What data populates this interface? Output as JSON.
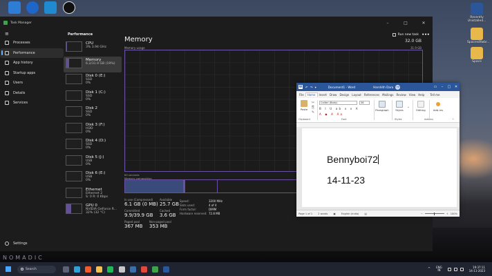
{
  "desktop": {
    "brand_text": "NOMADIC",
    "icons_right": [
      {
        "label": "Recently Unistalled...",
        "color": "#2b579a"
      },
      {
        "label": "Spaces4fwbr...",
        "color": "#e8b84a"
      },
      {
        "label": "Space",
        "color": "#e8b84a"
      }
    ]
  },
  "task_manager": {
    "window_title": "Task Manager",
    "section_title": "Performance",
    "run_new_task": "Run new task",
    "more": "•••",
    "sidebar": [
      {
        "label": "Processes",
        "name": "processes"
      },
      {
        "label": "Performance",
        "name": "performance",
        "active": true
      },
      {
        "label": "App history",
        "name": "app-history"
      },
      {
        "label": "Startup apps",
        "name": "startup-apps"
      },
      {
        "label": "Users",
        "name": "users"
      },
      {
        "label": "Details",
        "name": "details"
      },
      {
        "label": "Services",
        "name": "services"
      }
    ],
    "settings_label": "Settings",
    "perf_items": [
      {
        "name": "CPU",
        "l1": "3% 3.94 GHz",
        "l2": "",
        "l3": "",
        "fill": 0.03
      },
      {
        "name": "Memory",
        "l1": "6.2/31.9 GB (19%)",
        "l2": "",
        "l3": "",
        "fill": 0.19,
        "active": true
      },
      {
        "name": "Disk 0 (E:)",
        "l1": "SSD",
        "l2": "0%",
        "l3": "",
        "fill": 0.0
      },
      {
        "name": "Disk 1 (C:)",
        "l1": "SSD",
        "l2": "0%",
        "l3": "",
        "fill": 0.0
      },
      {
        "name": "Disk 2",
        "l1": "SSD",
        "l2": "0%",
        "l3": "",
        "fill": 0.0
      },
      {
        "name": "Disk 3 (F:)",
        "l1": "HDD",
        "l2": "0%",
        "l3": "",
        "fill": 0.0
      },
      {
        "name": "Disk 4 (D:)",
        "l1": "SSD",
        "l2": "0%",
        "l3": "",
        "fill": 0.0
      },
      {
        "name": "Disk 5 (J:)",
        "l1": "USB",
        "l2": "0%",
        "l3": "",
        "fill": 0.0
      },
      {
        "name": "Disk 6 (E:)",
        "l1": "USB",
        "l2": "0%",
        "l3": "",
        "fill": 0.0
      },
      {
        "name": "Ethernet",
        "l1": "Ethernet 2",
        "l2": "S: 0 R: 0 Kbps",
        "l3": "",
        "fill": 0.0
      },
      {
        "name": "GPU 0",
        "l1": "NVIDIA GeForce R...",
        "l2": "32% (32 °C)",
        "l3": "",
        "fill": 0.32
      }
    ],
    "memory": {
      "title": "Memory",
      "subtitle": "Memory usage",
      "total": "32.0 GB",
      "max_label": "31.9 GB",
      "graph_left_label": "60 seconds",
      "graph_right_label": "0",
      "composition_label": "Memory composition",
      "in_use_label": "In use (Compressed)",
      "in_use_value": "6.1 GB (0 MB)",
      "available_label": "Available",
      "available_value": "25.7 GB",
      "committed_label": "Committed",
      "committed_value": "9.9/39.9 GB",
      "cached_label": "Cached",
      "cached_value": "3.6 GB",
      "paged_label": "Paged pool",
      "paged_value": "367 MB",
      "nonpaged_label": "Non-paged pool",
      "nonpaged_value": "353 MB",
      "specs": [
        {
          "k": "Speed:",
          "v": "3200 MHz"
        },
        {
          "k": "Slots used:",
          "v": "4 of 4"
        },
        {
          "k": "Form factor:",
          "v": "DIMM"
        },
        {
          "k": "Hardware reserved:",
          "v": "72.8 MB"
        }
      ]
    }
  },
  "word": {
    "qa_icons": "↶ ↷ ▾",
    "doc_title": "Document1 - Word",
    "user": "Harshith Dara",
    "avatar": "HD",
    "tabs": [
      "File",
      "Home",
      "Insert",
      "Draw",
      "Design",
      "Layout",
      "References",
      "Mailings",
      "Review",
      "View",
      "Help"
    ],
    "active_tab": "Home",
    "tell_me": "Tell me",
    "font_name": "Calibri (Body)",
    "font_size": "36",
    "groups": {
      "clipboard": "Clipboard",
      "font": "Font",
      "styles": "Styles",
      "editing": "Editing",
      "addins": "Add-ins",
      "paste": "Paste",
      "paragraph": "Paragraph",
      "styles_btn": "Styles",
      "editing_btn": "Editing",
      "addins_btn": "Add-ins"
    },
    "format_glyphs": "B I U ab x x A",
    "lines": [
      "Bennyboi72",
      "14-11-23"
    ],
    "status": {
      "page": "Page 1 of 1",
      "words": "2 words",
      "language": "English (India)",
      "zoom": "100%"
    }
  },
  "taskbar": {
    "search_label": "Search",
    "apps": [
      {
        "name": "task-view",
        "color": "#5b6275"
      },
      {
        "name": "edge",
        "color": "#2fa0d8"
      },
      {
        "name": "brave",
        "color": "#f25a29"
      },
      {
        "name": "file-explorer",
        "color": "#f2c14e"
      },
      {
        "name": "spotify",
        "color": "#1db954"
      },
      {
        "name": "app-6",
        "color": "#c7c7c7"
      },
      {
        "name": "steam",
        "color": "#3c6ea8"
      },
      {
        "name": "app-8",
        "color": "#e04a3a"
      },
      {
        "name": "task-manager",
        "color": "#3fa34d"
      },
      {
        "name": "word",
        "color": "#2b579a"
      }
    ],
    "lang_top": "ENG",
    "lang_bottom": "IN",
    "time": "19:37:11",
    "date": "14-11-2023"
  }
}
